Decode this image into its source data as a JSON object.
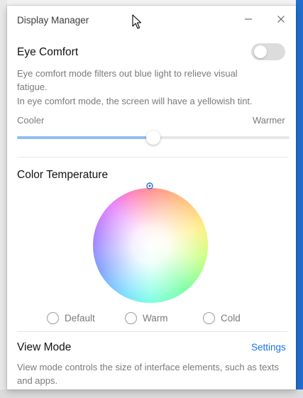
{
  "window": {
    "title": "Display Manager"
  },
  "eye_comfort": {
    "title": "Eye Comfort",
    "enabled": false,
    "description_line1": "Eye comfort mode filters out blue light to relieve visual",
    "description_line2": "fatigue.",
    "description_line3": "In eye comfort mode, the screen will have a yellowish tint.",
    "slider": {
      "min_label": "Cooler",
      "max_label": "Warmer",
      "value_percent": 50
    }
  },
  "color_temperature": {
    "title": "Color Temperature",
    "options": {
      "default": "Default",
      "warm": "Warm",
      "cold": "Cold"
    },
    "selected": ""
  },
  "view_mode": {
    "title": "View Mode",
    "settings_link": "Settings",
    "description_line1": "View mode controls the size of interface elements, such as texts",
    "description_line2": "and apps."
  },
  "colors": {
    "accent": "#1a73e8",
    "slider_fill": "#8ebdf2",
    "toggle_off": "#dcdcdc",
    "desktop_blue": "#1f6fd1"
  },
  "icons": {
    "minimize": "minimize-icon",
    "close": "close-icon",
    "cursor": "mouse-cursor-icon"
  }
}
